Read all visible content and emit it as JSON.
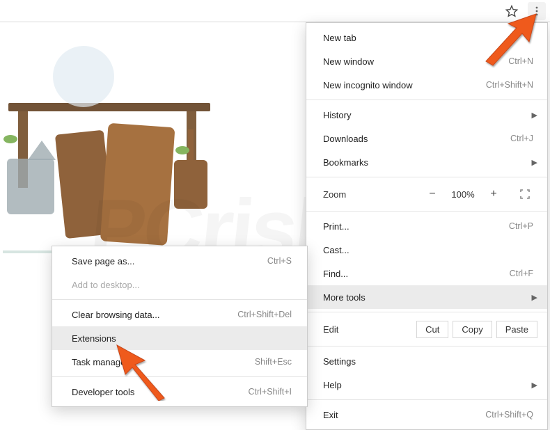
{
  "toolbar": {
    "star_title": "Bookmark this page",
    "menu_title": "Customize and control Google Chrome"
  },
  "main_menu": {
    "new_tab": "New tab",
    "new_window": "New window",
    "new_window_sc": "Ctrl+N",
    "new_incognito": "New incognito window",
    "new_incognito_sc": "Ctrl+Shift+N",
    "history": "History",
    "downloads": "Downloads",
    "downloads_sc": "Ctrl+J",
    "bookmarks": "Bookmarks",
    "zoom_label": "Zoom",
    "zoom_minus": "−",
    "zoom_value": "100%",
    "zoom_plus": "+",
    "print": "Print...",
    "print_sc": "Ctrl+P",
    "cast": "Cast...",
    "find": "Find...",
    "find_sc": "Ctrl+F",
    "more_tools": "More tools",
    "edit_label": "Edit",
    "cut": "Cut",
    "copy": "Copy",
    "paste": "Paste",
    "settings": "Settings",
    "help": "Help",
    "exit": "Exit",
    "exit_sc": "Ctrl+Shift+Q"
  },
  "submenu": {
    "save_page": "Save page as...",
    "save_page_sc": "Ctrl+S",
    "add_desktop": "Add to desktop...",
    "clear_data": "Clear browsing data...",
    "clear_data_sc": "Ctrl+Shift+Del",
    "extensions": "Extensions",
    "task_manager": "Task manager",
    "task_manager_sc": "Shift+Esc",
    "dev_tools": "Developer tools",
    "dev_tools_sc": "Ctrl+Shift+I"
  },
  "watermark": "PCrisk.com"
}
